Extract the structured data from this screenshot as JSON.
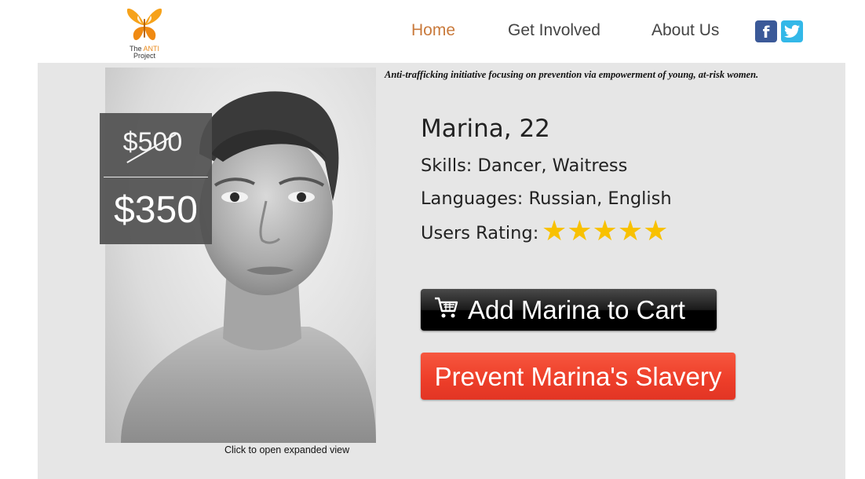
{
  "header": {
    "logo": {
      "line1_prefix": "The ",
      "line1_accent": "ANTI",
      "line2": "Project"
    },
    "nav": [
      {
        "label": "Home"
      },
      {
        "label": "Get Involved"
      },
      {
        "label": "About Us"
      }
    ],
    "social": {
      "facebook_glyph": "f",
      "twitter_icon": "twitter-bird-icon"
    }
  },
  "tagline": "Anti-trafficking initiative focusing on prevention via empowerment of young, at-risk women.",
  "profile": {
    "photo_caption": "Click to open expanded view",
    "old_price": "$500",
    "new_price": "$350",
    "name_age": "Marina, 22",
    "skills": "Skills: Dancer, Waitress",
    "languages": "Languages: Russian, English",
    "rating_label": "Users Rating:",
    "rating_stars": "★★★★★",
    "rating_value": 5,
    "rating_max": 5
  },
  "actions": {
    "add_to_cart": "Add Marina to Cart",
    "prevent": "Prevent Marina's Slavery"
  },
  "colors": {
    "nav_active": "#c97a3c",
    "facebook": "#3b5998",
    "twitter": "#33b8e8",
    "panel_bg": "#e6e6e6",
    "star": "#f8c100",
    "prevent_button": "#ee3f2a",
    "cart_button": "#000000"
  }
}
